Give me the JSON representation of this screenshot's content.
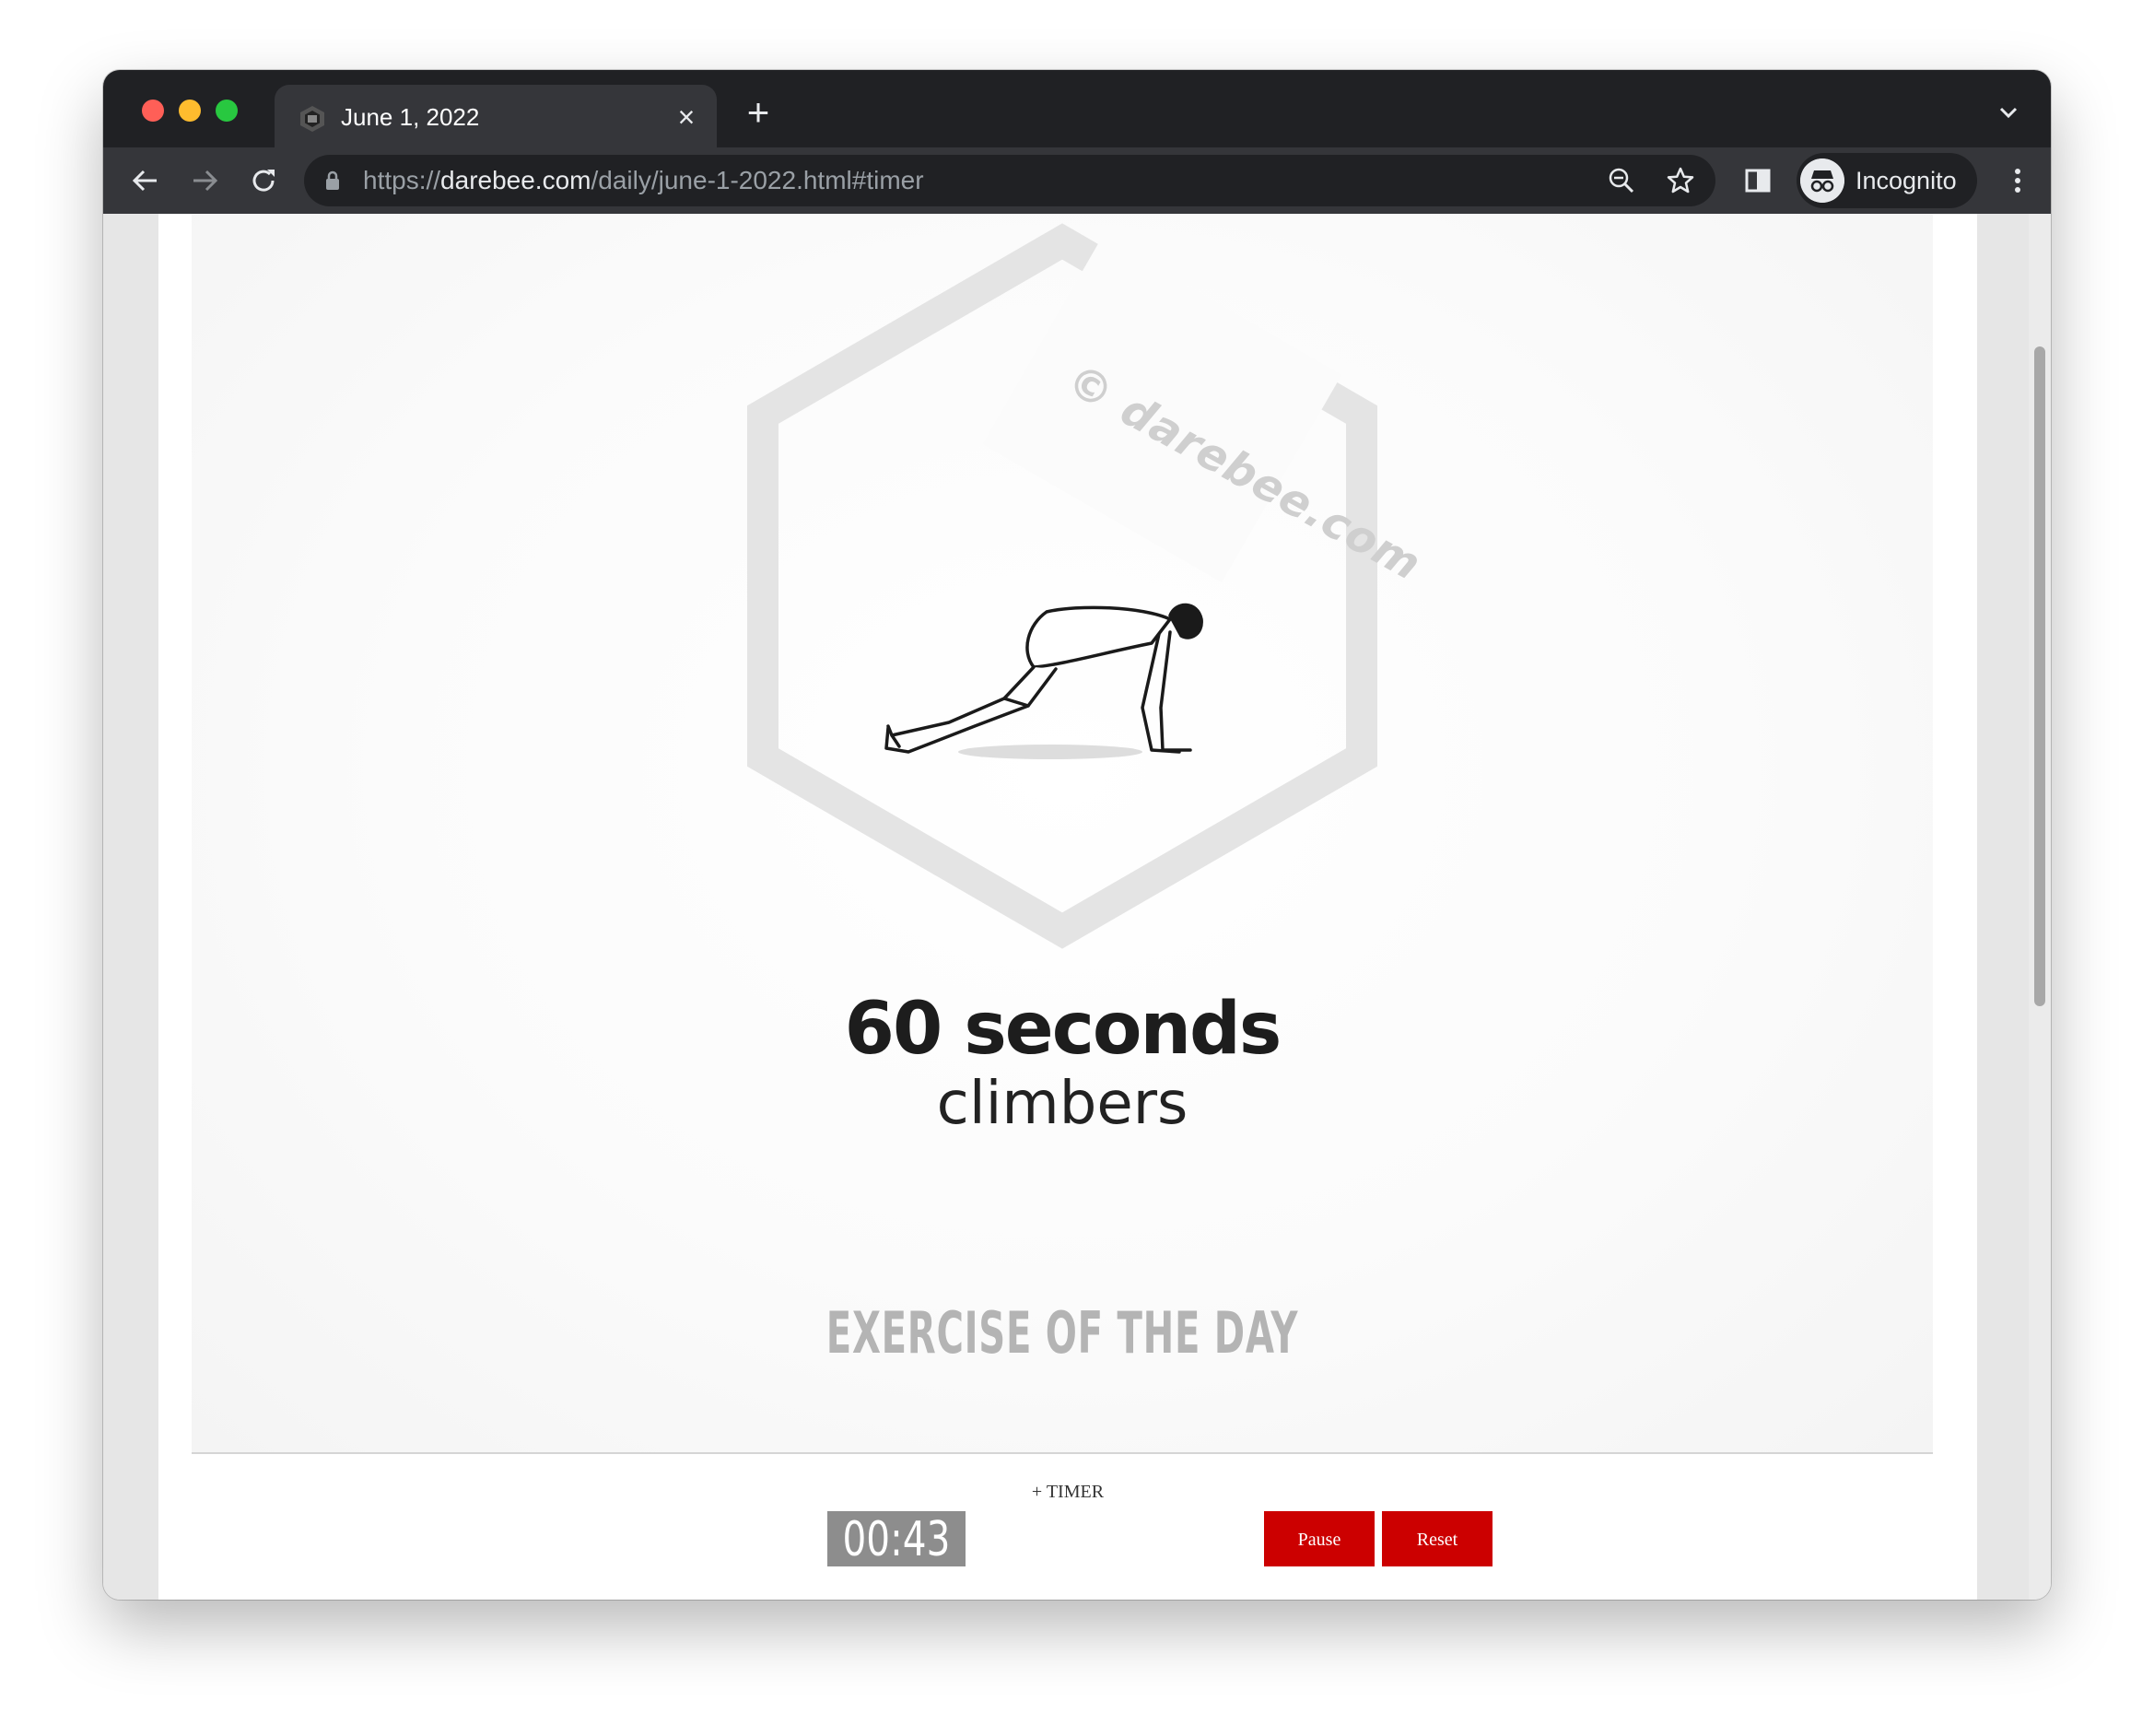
{
  "browser": {
    "tab_title": "June 1, 2022",
    "url_scheme": "https://",
    "url_host": "darebee.com",
    "url_path": "/daily/june-1-2022.html#timer",
    "profile_label": "Incognito"
  },
  "workout": {
    "watermark": "© darebee.com",
    "duration": "60 seconds",
    "exercise": "climbers",
    "section_title": "EXERCISE OF THE DAY"
  },
  "timer": {
    "link_label": "+ TIMER",
    "display": "00:43",
    "pause_label": "Pause",
    "reset_label": "Reset"
  },
  "colors": {
    "accent_red": "#cc0000",
    "timer_gray": "#8d8d8d",
    "browser_dark": "#202124"
  },
  "icons": [
    "darebee-favicon",
    "close-icon",
    "plus-icon",
    "chevron-down-icon",
    "back-arrow-icon",
    "forward-arrow-icon",
    "reload-icon",
    "lock-icon",
    "zoom-icon",
    "star-icon",
    "side-panel-icon",
    "incognito-icon",
    "kebab-menu-icon"
  ]
}
